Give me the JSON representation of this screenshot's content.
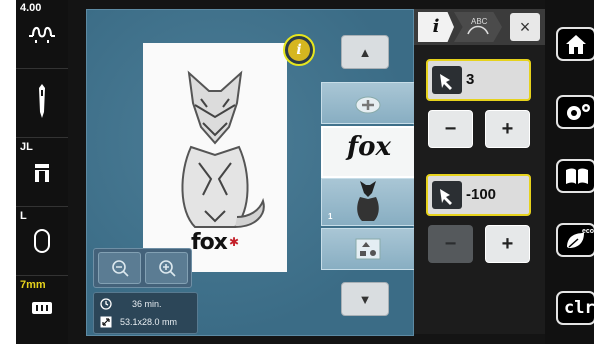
{
  "status": {
    "stitch_width": "4.00",
    "presser_foot": "JL",
    "hoop": "L",
    "thread_length": "7mm"
  },
  "embroidery": {
    "design_text": "fox",
    "zoom_out_icon": "zoom-out-icon",
    "zoom_in_icon": "zoom-in-icon",
    "time": "36 min.",
    "size": "53.1x28.0 mm"
  },
  "layers": [
    {
      "type": "add",
      "number": ""
    },
    {
      "type": "text",
      "label": "fox",
      "number": ""
    },
    {
      "type": "design",
      "number": "1"
    },
    {
      "type": "shapes",
      "number": ""
    }
  ],
  "panel": {
    "tab_info": "i",
    "value_1": "3",
    "value_2": "-100",
    "minus": "−",
    "plus": "+",
    "close": "×"
  },
  "nav": {
    "home_icon": "home-icon",
    "settings_icon": "settings-icon",
    "tutorial_icon": "book-icon",
    "eco_label": "eco",
    "clr_label": "clr"
  },
  "colors": {
    "accent_yellow": "#e6d21c",
    "workspace_blue": "#3b6c86",
    "layer_blue": "#9ebfd0"
  }
}
